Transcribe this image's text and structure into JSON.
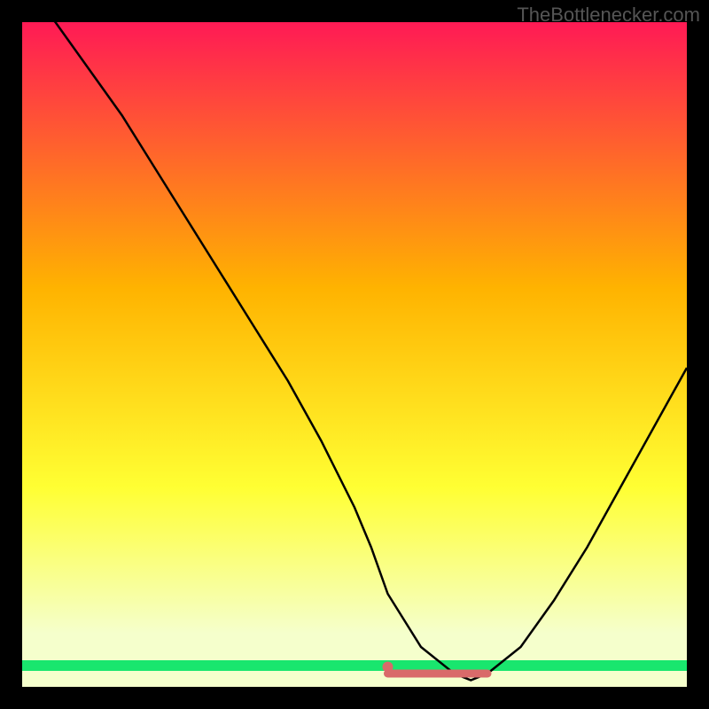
{
  "watermark": "TheBottlenecker.com",
  "chart_data": {
    "type": "line",
    "title": "",
    "xlabel": "",
    "ylabel": "",
    "xlim": [
      0,
      100
    ],
    "ylim": [
      0,
      100
    ],
    "series": [
      {
        "name": "curve",
        "x": [
          0,
          5,
          10,
          15,
          20,
          25,
          30,
          35,
          40,
          45,
          50,
          52.5,
          55,
          60,
          65,
          67.5,
          70,
          75,
          80,
          85,
          90,
          95,
          100
        ],
        "values": [
          105,
          100,
          93,
          86,
          78,
          70,
          62,
          54,
          46,
          37,
          27,
          21,
          14,
          6,
          2,
          1,
          2,
          6,
          13,
          21,
          30,
          39,
          48
        ]
      }
    ],
    "flat_region": {
      "x_start": 55,
      "x_end": 70,
      "y": 2
    },
    "marker": {
      "x": 55,
      "y": 3
    },
    "background_gradient": {
      "top": "#ff1a55",
      "mid1": "#ffb300",
      "mid2": "#ffff33",
      "low": "#f5ffcc",
      "bottom_band": "#19e66e"
    }
  }
}
